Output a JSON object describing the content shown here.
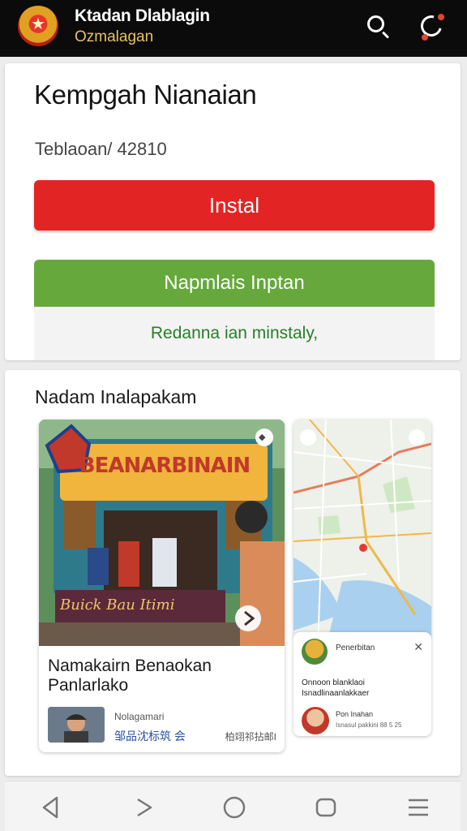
{
  "header": {
    "title": "Ktadan Dlablagin",
    "subtitle": "Ozmalagan",
    "logo_icon": "emblem-logo",
    "search_icon": "search-icon",
    "refresh_icon": "refresh-icon"
  },
  "app": {
    "name": "Kempgah Nianaian",
    "meta": "Teblaoan/ 42810",
    "install_label": "Instal",
    "secondary_label": "Napmlais Inptan",
    "secondary_note": "Redanna ian minstaly,"
  },
  "section": {
    "title": "Nadam Inalapakam",
    "tiles": [
      {
        "image_sign": "BEANARBINAIN",
        "image_banner": "Buick Bau Itimi",
        "title": "Namakairn Benaokan Panlarlako",
        "author": "Nolagamari",
        "tags": "邹品沈标筑 会",
        "count": "柏翊祁拈邮I"
      },
      {
        "card_label": "Penerbitan",
        "card_line": "Onnoon blanklaoi Isnadlinaanlakkaer",
        "card_name": "Pon Inahan",
        "card_meta": "Isnasul pakkini 88 5 25"
      }
    ]
  },
  "nav": {
    "items": [
      "back-icon",
      "forward-icon",
      "home-icon",
      "tabs-icon",
      "menu-icon"
    ]
  },
  "colors": {
    "header_bg": "#0b0b0b",
    "install": "#e32424",
    "secondary": "#66a83c",
    "secondary_note_text": "#2a7d2a"
  }
}
